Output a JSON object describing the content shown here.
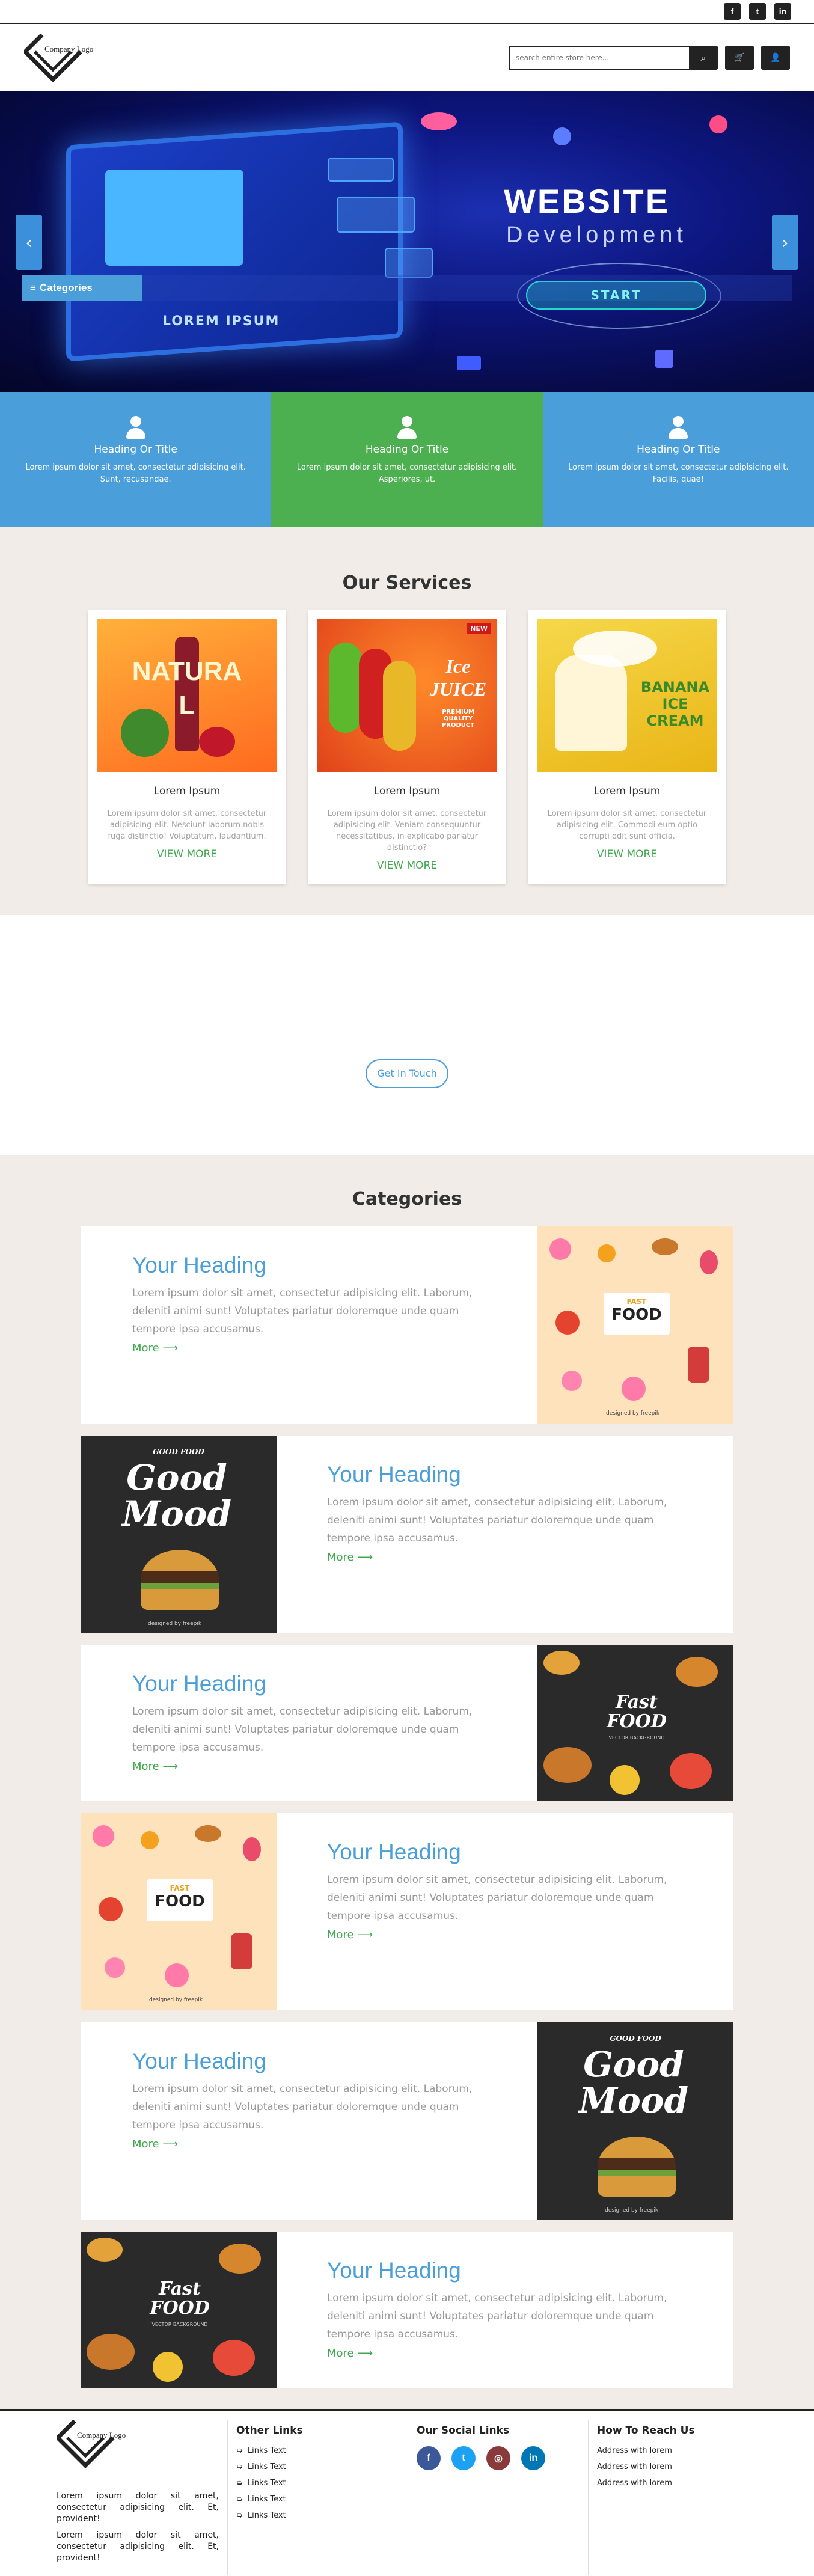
{
  "topbar": {
    "icons": [
      "facebook-icon",
      "twitter-icon",
      "linkedin-icon"
    ],
    "glyphs": [
      "f",
      "t",
      "in"
    ]
  },
  "header": {
    "logo_text": "Company Logo",
    "search_placeholder": "search entire store here...",
    "search_glyph": "⌕",
    "cart_glyph": "🛒",
    "user_glyph": "👤"
  },
  "hero": {
    "title": "WEBSITE",
    "subtitle": "Development",
    "start_label": "START",
    "screen_text": "LOREM IPSUM",
    "prev_glyph": "‹",
    "next_glyph": "›",
    "categories_label": "Categories",
    "categories_glyph": "≡"
  },
  "features": [
    {
      "title": "Heading Or Title",
      "text": "Lorem ipsum dolor sit amet, consectetur adipisicing elit. Sunt, recusandae.",
      "color": "#4a9fdb"
    },
    {
      "title": "Heading Or Title",
      "text": "Lorem ipsum dolor sit amet, consectetur adipisicing elit. Asperiores, ut.",
      "color": "#4caf50"
    },
    {
      "title": "Heading Or Title",
      "text": "Lorem ipsum dolor sit amet, consectetur adipisicing elit. Facilis, quae!",
      "color": "#4a9fdb"
    }
  ],
  "services": {
    "title": "Our Services",
    "cards": [
      {
        "title": "Lorem Ipsum",
        "text": "Lorem ipsum dolor sit amet, consectetur adipisicing elit. Nesciunt laborum nobis fuga distinctio! Voluptatum, laudantium.",
        "more": "VIEW MORE",
        "image_text": "NATURAL"
      },
      {
        "title": "Lorem Ipsum",
        "text": "Lorem ipsum dolor sit amet, consectetur adipisicing elit. Veniam consequuntur necessitatibus, in explicabo pariatur distinctio?",
        "more": "VIEW MORE",
        "image_text": "Ice JUICE",
        "image_sub": "PREMIUM QUALITY PRODUCT",
        "badge": "NEW"
      },
      {
        "title": "Lorem Ipsum",
        "text": "Lorem ipsum dolor sit amet, consectetur adipisicing elit. Commodi eum optio corrupti odit sunt officia.",
        "more": "VIEW MORE",
        "image_text": "BANANA ICE CREAM"
      }
    ]
  },
  "touch": {
    "label": "Get In Touch"
  },
  "categories": {
    "title": "Categories",
    "rows": [
      {
        "heading": "Your Heading",
        "text": "Lorem ipsum dolor sit amet, consectetur adipisicing elit. Laborum, deleniti animi sunt! Voluptates pariatur doloremque unde quam tempore ipsa accusamus.",
        "more": "More ⟶",
        "image": "fast-food-light",
        "image_text": "FOOD",
        "image_small": "FAST",
        "credit": "designed by freepik"
      },
      {
        "heading": "Your Heading",
        "text": "Lorem ipsum dolor sit amet, consectetur adipisicing elit. Laborum, deleniti animi sunt! Voluptates pariatur doloremque unde quam tempore ipsa accusamus.",
        "more": "More ⟶",
        "image": "good-mood",
        "image_text": "Good Mood",
        "image_small": "GOOD FOOD",
        "credit": "designed by freepik"
      },
      {
        "heading": "Your Heading",
        "text": "Lorem ipsum dolor sit amet, consectetur adipisicing elit. Laborum, deleniti animi sunt! Voluptates pariatur doloremque unde quam tempore ipsa accusamus.",
        "more": "More ⟶",
        "image": "fast-food-dark",
        "image_text": "Fast FOOD",
        "image_small": "VECTOR BACKGROUND"
      },
      {
        "heading": "Your Heading",
        "text": "Lorem ipsum dolor sit amet, consectetur adipisicing elit. Laborum, deleniti animi sunt! Voluptates pariatur doloremque unde quam tempore ipsa accusamus.",
        "more": "More ⟶",
        "image": "fast-food-light",
        "image_text": "FOOD",
        "image_small": "FAST",
        "credit": "designed by freepik"
      },
      {
        "heading": "Your Heading",
        "text": "Lorem ipsum dolor sit amet, consectetur adipisicing elit. Laborum, deleniti animi sunt! Voluptates pariatur doloremque unde quam tempore ipsa accusamus.",
        "more": "More ⟶",
        "image": "good-mood",
        "image_text": "Good Mood",
        "image_small": "GOOD FOOD",
        "credit": "designed by freepik"
      },
      {
        "heading": "Your Heading",
        "text": "Lorem ipsum dolor sit amet, consectetur adipisicing elit. Laborum, deleniti animi sunt! Voluptates pariatur doloremque unde quam tempore ipsa accusamus.",
        "more": "More ⟶",
        "image": "fast-food-dark",
        "image_text": "Fast FOOD",
        "image_small": "VECTOR BACKGROUND"
      }
    ]
  },
  "footer": {
    "logo_text": "Company Logo",
    "about": [
      "Lorem ipsum dolor sit amet, consectetur adipisicing elit. Et, provident!",
      "Lorem ipsum dolor sit amet, consectetur adipisicing elit. Et, provident!"
    ],
    "links_title": "Other Links",
    "links": [
      "Links Text",
      "Links Text",
      "Links Text",
      "Links Text",
      "Links Text"
    ],
    "link_glyph": "➭",
    "social_title": "Our Social Links",
    "social": [
      {
        "icon": "facebook-icon",
        "glyph": "f",
        "color": "#3b5998"
      },
      {
        "icon": "twitter-icon",
        "glyph": "t",
        "color": "#1da1f2"
      },
      {
        "icon": "instagram-icon",
        "glyph": "◎",
        "color": "#8a3a3a"
      },
      {
        "icon": "linkedin-icon",
        "glyph": "in",
        "color": "#0077b5"
      }
    ],
    "reach_title": "How To Reach Us",
    "addresses": [
      "Address with lorem",
      "Address with lorem",
      "Address with lorem"
    ]
  }
}
